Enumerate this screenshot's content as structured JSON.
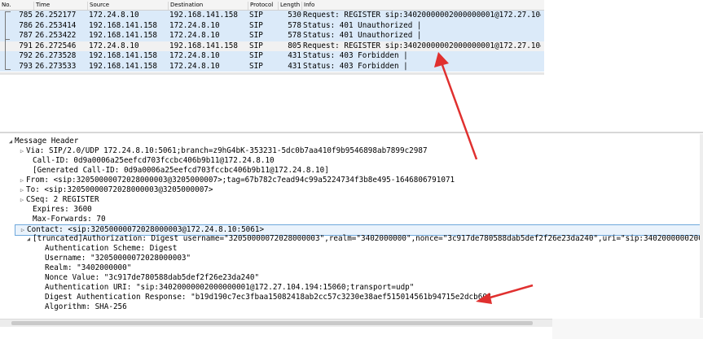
{
  "packet_list": {
    "columns": [
      "No.",
      "Time",
      "Source",
      "Destination",
      "Protocol",
      "Length",
      "Info"
    ],
    "rows": [
      {
        "no": "785",
        "time": "26.252177",
        "source": "172.24.8.10",
        "destination": "192.168.141.158",
        "protocol": "SIP",
        "length": "530",
        "info": "Request: REGISTER sip:34020000002000000001@172.27.104..."
      },
      {
        "no": "786",
        "time": "26.253414",
        "source": "192.168.141.158",
        "destination": "172.24.8.10",
        "protocol": "SIP",
        "length": "578",
        "info": "Status: 401 Unauthorized |"
      },
      {
        "no": "787",
        "time": "26.253422",
        "source": "192.168.141.158",
        "destination": "172.24.8.10",
        "protocol": "SIP",
        "length": "578",
        "info": "Status: 401 Unauthorized |"
      },
      {
        "no": "791",
        "time": "26.272546",
        "source": "172.24.8.10",
        "destination": "192.168.141.158",
        "protocol": "SIP",
        "length": "805",
        "info": "Request: REGISTER sip:34020000002000000001@172.27.104..."
      },
      {
        "no": "792",
        "time": "26.273528",
        "source": "192.168.141.158",
        "destination": "172.24.8.10",
        "protocol": "SIP",
        "length": "431",
        "info": "Status: 403 Forbidden |"
      },
      {
        "no": "793",
        "time": "26.273533",
        "source": "192.168.141.158",
        "destination": "172.24.8.10",
        "protocol": "SIP",
        "length": "431",
        "info": "Status: 403 Forbidden |"
      }
    ],
    "selected_row": 3
  },
  "details": {
    "lines": [
      {
        "text": "Message Header",
        "arrow": "down"
      },
      {
        "text": "Via: SIP/2.0/UDP 172.24.8.10:5061;branch=z9hG4bK-353231-5dc0b7aa410f9b9546898ab7899c2987",
        "arrow": "right"
      },
      {
        "text": "Call-ID: 0d9a0006a25eefcd703fccbc406b9b11@172.24.8.10",
        "arrow": ""
      },
      {
        "text": "[Generated Call-ID: 0d9a0006a25eefcd703fccbc406b9b11@172.24.8.10]",
        "arrow": ""
      },
      {
        "text": "From: <sip:32050000072028000003@3205000007>;tag=67b782c7ead94c99a5224734f3b8e495-1646806791071",
        "arrow": "right"
      },
      {
        "text": "To: <sip:32050000072028000003@3205000007>",
        "arrow": "right"
      },
      {
        "text": "CSeq: 2 REGISTER",
        "arrow": "right"
      },
      {
        "text": "Expires: 3600",
        "arrow": ""
      },
      {
        "text": "Max-Forwards: 70",
        "arrow": ""
      },
      {
        "text": "Contact: <sip:32050000072028000003@172.24.8.10:5061>",
        "arrow": "right"
      },
      {
        "text": "[truncated]Authorization: Digest username=\"32050000072028000003\",realm=\"3402000000\",nonce=\"3c917de780588dab5def2f26e23da240\",uri=\"sip:34020000002000000001@",
        "arrow": "down"
      },
      {
        "text": "Authentication Scheme: Digest",
        "arrow": ""
      },
      {
        "text": "Username: \"32050000072028000003\"",
        "arrow": ""
      },
      {
        "text": "Realm: \"3402000000\"",
        "arrow": ""
      },
      {
        "text": "Nonce Value: \"3c917de780588dab5def2f26e23da240\"",
        "arrow": ""
      },
      {
        "text": "Authentication URI: \"sip:34020000002000000001@172.27.104.194:15060;transport=udp\"",
        "arrow": ""
      },
      {
        "text": "Digest Authentication Response: \"b19d190c7ec3fbaa15082418ab2cc57c3230e38aef515014561b94715e2dcb60\"",
        "arrow": ""
      },
      {
        "text": "Algorithm: SHA-256",
        "arrow": ""
      }
    ]
  },
  "colors": {
    "row_bg": "#dbeaf9",
    "selected_row_bg": "#f1f1f1",
    "annotation_red": "#e0302f"
  },
  "icons": {
    "expand": "triangle-right",
    "collapse": "triangle-down"
  }
}
